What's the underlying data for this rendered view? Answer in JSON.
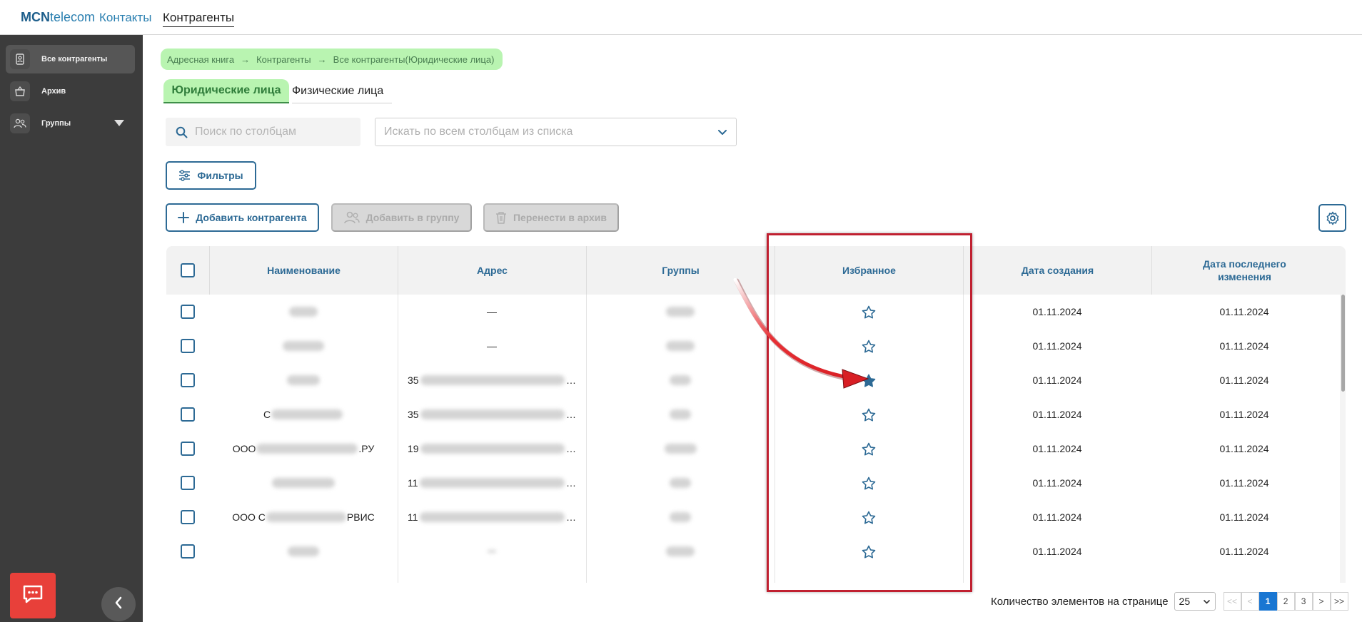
{
  "topbar": {
    "logo_bold": "MCN",
    "logo_rest": "telecom",
    "nav": [
      {
        "label": "Контакты",
        "active": false
      },
      {
        "label": "Контрагенты",
        "active": true
      }
    ]
  },
  "sidebar": {
    "items": [
      {
        "label": "Все контрагенты",
        "icon": "contact-card-icon",
        "active": true
      },
      {
        "label": "Архив",
        "icon": "archive-box-icon",
        "active": false
      },
      {
        "label": "Группы",
        "icon": "users-group-icon",
        "active": false
      }
    ],
    "chat_icon": "chat-bubble-icon",
    "collapse_icon": "chevron-left-icon"
  },
  "breadcrumb": [
    "Адресная книга",
    "Контрагенты",
    "Все контрагенты(Юридические лица)"
  ],
  "tabs": [
    {
      "label": "Юридические лица",
      "active": true
    },
    {
      "label": "Физические лица",
      "active": false
    }
  ],
  "search": {
    "placeholder": "Поиск по столбцам",
    "select_placeholder": "Искать по всем столбцам из списка"
  },
  "buttons": {
    "filters": "Фильтры",
    "add_counterparty": "Добавить контрагента",
    "add_to_group": "Добавить в группу",
    "move_to_archive": "Перенести в архив"
  },
  "table": {
    "columns": [
      "Наименование",
      "Адрес",
      "Группы",
      "Избранное",
      "Дата создания",
      "Дата последнего изменения"
    ],
    "rows": [
      {
        "name": "",
        "address": "—",
        "groups": "",
        "favorite": false,
        "created": "01.11.2024",
        "modified": "01.11.2024"
      },
      {
        "name": "",
        "address": "—",
        "groups": "",
        "favorite": false,
        "created": "01.11.2024",
        "modified": "01.11.2024"
      },
      {
        "name": "",
        "address": "35",
        "groups": "",
        "favorite": true,
        "created": "01.11.2024",
        "modified": "01.11.2024"
      },
      {
        "name": "С",
        "address": "35",
        "groups": "",
        "favorite": false,
        "created": "01.11.2024",
        "modified": "01.11.2024"
      },
      {
        "name": "ООО",
        "name_suffix": ".РУ",
        "address": "19",
        "groups": "",
        "favorite": false,
        "created": "01.11.2024",
        "modified": "01.11.2024"
      },
      {
        "name": "",
        "address": "11",
        "groups": "",
        "favorite": false,
        "created": "01.11.2024",
        "modified": "01.11.2024"
      },
      {
        "name": "ООО С",
        "name_suffix": "РВИС",
        "address": "11",
        "groups": "",
        "favorite": false,
        "created": "01.11.2024",
        "modified": "01.11.2024"
      },
      {
        "name": "",
        "address": "",
        "groups": "",
        "favorite": false,
        "created": "01.11.2024",
        "modified": "01.11.2024"
      }
    ]
  },
  "pagination": {
    "label": "Количество элементов на странице",
    "page_size": "25",
    "buttons": [
      "<<",
      "<",
      "1",
      "2",
      "3",
      ">",
      ">>"
    ],
    "current_page": "1"
  },
  "colors": {
    "accent": "#2d6a95",
    "breadcrumb_bg": "#b9f4b1",
    "sidebar_bg": "#3c3c3c",
    "annotation_red": "#c02030",
    "chat_red": "#e8403a",
    "active_page": "#1976d2"
  }
}
